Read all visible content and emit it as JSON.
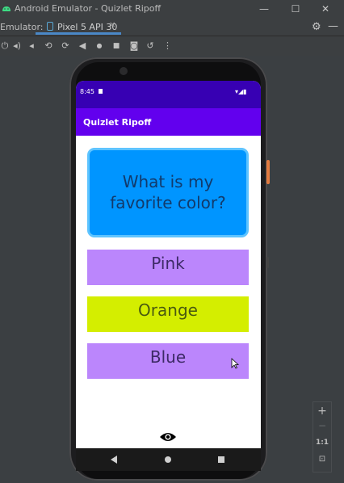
{
  "window": {
    "title": "Android Emulator - Quizlet Ripoff",
    "controls": [
      "—",
      "☐",
      "✕"
    ]
  },
  "tabbar": {
    "emulator_label": "Emulator:",
    "device_tab": "Pixel 5 API 30",
    "close_glyph": "✕",
    "settings_icon": "gear-icon",
    "minimize_glyph": "—"
  },
  "toolbar": {
    "icons": [
      "power-icon",
      "volume-up-icon",
      "volume-down-icon",
      "rotate-left-icon",
      "rotate-right-icon",
      "back-icon",
      "home-icon",
      "overview-icon",
      "screenshot-icon",
      "replay-icon",
      "more-icon"
    ],
    "glyphs": [
      "⏻",
      "◂)",
      "◂",
      "⟲",
      "⟳",
      "◀",
      "●",
      "■",
      "◙",
      "↺",
      "⋮"
    ]
  },
  "zoom": {
    "plus": "+",
    "minus": "−",
    "one_to_one": "1:1"
  },
  "phone": {
    "status_time": "8:45",
    "app_title": "Quizlet Ripoff",
    "question": "What is my favorite color?",
    "answers": [
      {
        "label": "Pink",
        "bg": "#bb86fc",
        "color": "#3d2a66"
      },
      {
        "label": "Orange",
        "bg": "#d4ee00",
        "color": "#4a5a10"
      },
      {
        "label": "Blue",
        "bg": "#bb86fc",
        "color": "#3d2a66"
      }
    ],
    "toggle_icon": "eye-icon"
  },
  "colors": {
    "status_bar": "#3700b3",
    "app_bar": "#6200ee",
    "flashcard": "#0095ff",
    "flashcard_border": "#5ec4ff"
  }
}
